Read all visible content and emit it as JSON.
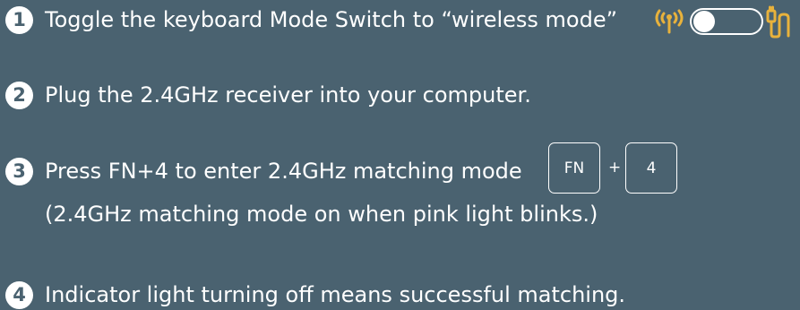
{
  "colors": {
    "background": "#4a6270",
    "text": "#ffffff",
    "accent": "#e8b23c"
  },
  "steps": [
    {
      "number": "1",
      "text": "Toggle the keyboard Mode Switch to “wireless mode”"
    },
    {
      "number": "2",
      "text": "Plug the 2.4GHz receiver into your computer."
    },
    {
      "number": "3",
      "text": "Press FN+4 to enter 2.4GHz matching mode",
      "subtext": "(2.4GHz matching mode on when pink light blinks.)"
    },
    {
      "number": "4",
      "text": "Indicator light turning off means successful matching."
    }
  ],
  "keys": {
    "fn_label": "FN",
    "plus_label": "+",
    "four_label": "4"
  },
  "icons": {
    "wireless": "wireless-signal-icon",
    "toggle": "mode-toggle-switch",
    "wired": "usb-cable-plug-icon"
  }
}
